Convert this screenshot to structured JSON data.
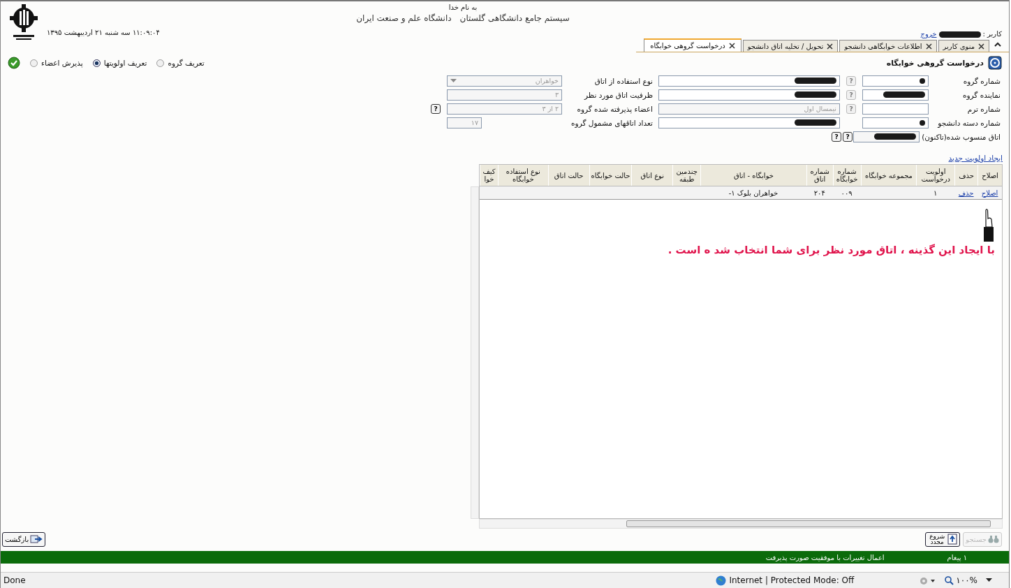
{
  "header": {
    "blessing": "به نام خدا",
    "system_title": "سیستم جامع دانشگاهی گلستان",
    "university": "دانشگاه علم و صنعت ایران",
    "datetime": "۱۱:۰۹:۰۴ سه شنبه ۲۱ اردیبهشت ۱۳۹۵",
    "user_label": "کاربر :",
    "user_redacted": true,
    "logout": "خروج"
  },
  "tabs": [
    {
      "label": "منوی کاربر",
      "selected": false
    },
    {
      "label": "اطلاعات خوابگاهی دانشجو",
      "selected": false
    },
    {
      "label": "تحویل / تخلیه اتاق دانشجو",
      "selected": false
    },
    {
      "label": "درخواست گروهی خوابگاه",
      "selected": true
    }
  ],
  "page_title": "درخواست گروهی خوابگاه",
  "modes": [
    {
      "label": "تعریف گروه",
      "selected": false
    },
    {
      "label": "تعریف اولویتها",
      "selected": true
    },
    {
      "label": "پذیرش اعضاء",
      "selected": false
    }
  ],
  "form_rows": [
    {
      "label": "شماره گروه",
      "field": {
        "redacted": true
      },
      "helps": [
        {
          "label": "?",
          "disabled": true
        }
      ],
      "wide": {
        "redacted": true
      },
      "side": {
        "label": "نوع استفاده از اتاق",
        "kind": "select",
        "value": "خواهران",
        "disabled": true
      }
    },
    {
      "label": "نماینده گروه",
      "field": {
        "redacted": true
      },
      "helps": [
        {
          "label": "?",
          "disabled": true
        }
      ],
      "wide": {
        "redacted": true
      },
      "side": {
        "label": "ظرفیت اتاق مورد نظر",
        "kind": "text",
        "value": "۳",
        "disabled": true
      }
    },
    {
      "label": "شماره ترم",
      "field": {
        "redacted": false
      },
      "helps": [
        {
          "label": "?",
          "disabled": true
        }
      ],
      "wide": {
        "redacted": false,
        "value": "نیمسال اول",
        "disabled": true
      },
      "side": {
        "label": "اعضاء پذیرفته شده گروه",
        "kind": "text",
        "value": "۲ از ۳",
        "disabled": true,
        "help": {
          "label": "?",
          "disabled": false
        }
      }
    },
    {
      "label": "شماره دسته دانشجو",
      "field": {
        "redacted": true
      },
      "wide": {
        "redacted": true
      },
      "side": {
        "label": "تعداد اتاقهای مشمول گروه",
        "kind": "short",
        "value": "۱۷",
        "disabled": true
      }
    },
    {
      "label": "اتاق منسوب شده(تاکنون)",
      "field": {
        "redacted": true,
        "disabled": true
      },
      "helps": [
        {
          "label": "?",
          "disabled": false
        },
        {
          "label": "?",
          "disabled": false
        }
      ]
    }
  ],
  "table": {
    "new_link": "ایجاد اولویت جدید",
    "columns": [
      "اصلاح",
      "حذف",
      "اولویت درخواست",
      "مجموعه خوابگاه",
      "شماره خوابگاه",
      "شماره اتاق",
      "خوابگاه - اتاق",
      "چندمین طبقه",
      "نوع اتاق",
      "حالت خوابگاه",
      "حالت اتاق",
      "نوع استفاده خوابگاه",
      "کیف خوا"
    ],
    "rows": [
      {
        "cells": [
          {
            "text": "اصلاح",
            "kind": "link"
          },
          {
            "text": "حذف",
            "kind": "link"
          },
          {
            "text": "۱",
            "kind": "text"
          },
          null,
          {
            "text": "۰۰۹",
            "kind": "text"
          },
          {
            "text": "۲۰۴",
            "kind": "text"
          },
          {
            "text": "خواهران بلوک ۱-",
            "kind": "text"
          }
        ]
      }
    ]
  },
  "hint": "با ایجاد این گذینه ، اتاق مورد نظر برای شما انتخاب شد ه است .",
  "buttons": {
    "back": {
      "label": "بازگشت",
      "disabled": false
    },
    "restart": {
      "label": "شروع مجدد",
      "disabled": false
    },
    "search": {
      "label": "جستجو",
      "disabled": true
    }
  },
  "message_bar": {
    "count": "۱ پیغام",
    "text": "اعمال تغییرات با موفقیت صورت پذیرفت"
  },
  "browser_status": {
    "done": "Done",
    "zone": "Internet | Protected Mode: Off",
    "zoom": "۱۰۰%"
  }
}
